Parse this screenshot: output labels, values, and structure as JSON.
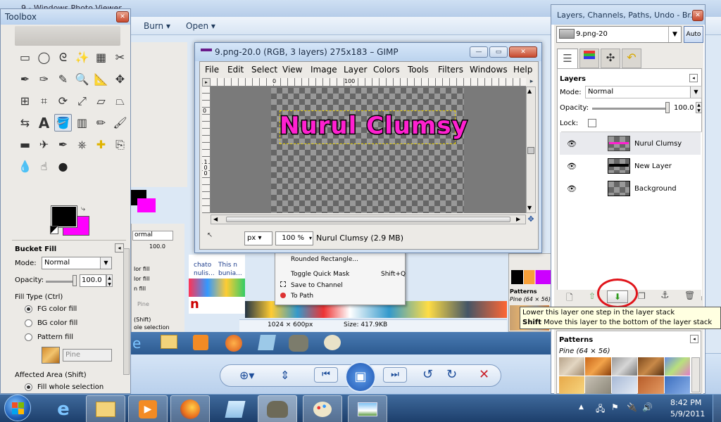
{
  "desktop": {
    "bg_window_title": "9 - Windows Photo Viewer",
    "bg_menu": [
      "Burn",
      "Open"
    ],
    "photo_viewer_status": {
      "dimensions": "1024 × 600px",
      "size": "Size: 417.9KB"
    },
    "bg_text": {
      "a": "chato",
      "b": "This n",
      "c": "Rounded Rectangle...",
      "d": "Toggle Quick Mask",
      "e": "Shift+Q",
      "f": "Save to Channel",
      "g": "To Path",
      "h": "nulis...",
      "i": "bunia..."
    }
  },
  "toolbox": {
    "title": "Toolbox",
    "tool_icons": [
      "rect-select",
      "ellipse-select",
      "free-select",
      "fuzzy-select",
      "select-by-color",
      "scissors",
      "foreground-select",
      "paths",
      "color-picker",
      "zoom",
      "measure",
      "move",
      "align",
      "crop",
      "rotate",
      "scale",
      "shear",
      "perspective",
      "flip",
      "text",
      "bucket-fill",
      "blend",
      "pencil",
      "paintbrush",
      "eraser",
      "airbrush",
      "ink",
      "clone",
      "heal",
      "perspective-clone",
      "blur",
      "smudge",
      "dodge-burn"
    ],
    "fg_color": "#000000",
    "bg_color": "#ff00ff",
    "options_title": "Bucket Fill",
    "mode_label": "Mode:",
    "mode_value": "Normal",
    "opacity_label": "Opacity:",
    "opacity_value": "100.0",
    "fill_type_label": "Fill Type  (Ctrl)",
    "fill_types": [
      "FG color fill",
      "BG color fill",
      "Pattern fill"
    ],
    "pattern_name": "Pine",
    "affected_area_label": "Affected Area  (Shift)",
    "fill_whole_selection": "Fill whole selection"
  },
  "behind_panel": {
    "mode": "ormal",
    "opacity": "100.0",
    "items": [
      "lor fill",
      "lor fill",
      "n fill",
      "Pine",
      "(Shift)",
      "ole selection"
    ]
  },
  "gimp_image": {
    "title": "9.png-20.0 (RGB, 3 layers) 275x183 – GIMP",
    "menus": [
      "File",
      "Edit",
      "Select",
      "View",
      "Image",
      "Layer",
      "Colors",
      "Tools",
      "Filters",
      "Windows",
      "Help"
    ],
    "canvas_text": "Nurul Clumsy",
    "unit": "px",
    "zoom": "100 %",
    "status": "Nurul Clumsy (2.9 MB)",
    "ruler_labels": [
      "0",
      "100",
      "100"
    ]
  },
  "layers_dialog": {
    "title": "Layers, Channels, Paths, Undo - Br...",
    "image_select": "9.png-20",
    "auto_label": "Auto",
    "section_title": "Layers",
    "mode_label": "Mode:",
    "mode_value": "Normal",
    "opacity_label": "Opacity:",
    "opacity_value": "100.0",
    "lock_label": "Lock:",
    "layers": [
      {
        "name": "Nurul Clumsy",
        "selected": true
      },
      {
        "name": "New Layer",
        "selected": false
      },
      {
        "name": "Background",
        "selected": false
      }
    ],
    "tooltip_line1": "Lower this layer one step in the layer stack",
    "tooltip_line2_bold": "Shift",
    "tooltip_line2": "  Move this layer to the bottom of the layer stack",
    "patterns_title": "Patterns",
    "patterns_subtitle": "Pine (64 × 56)",
    "patterns_title_small": "Patterns",
    "patterns_sub_small": "Pine (64 × 56)",
    "highlight_color": "#e0151b"
  },
  "taskbar": {
    "time": "8:42 PM",
    "date": "5/9/2011"
  }
}
